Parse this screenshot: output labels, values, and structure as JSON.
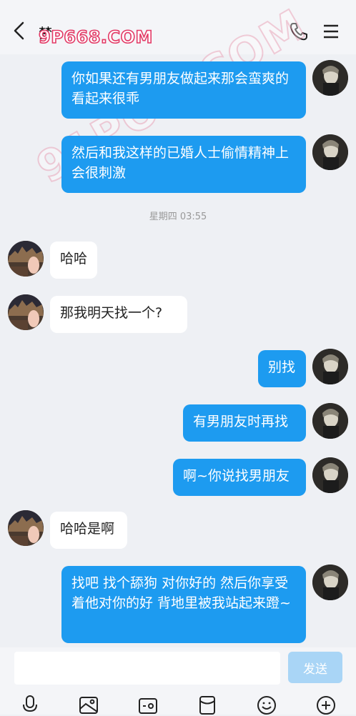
{
  "header": {
    "title": "梦",
    "watermark": "9P668.COM",
    "icons": [
      "back-icon",
      "phone-icon",
      "menu-icon"
    ]
  },
  "watermark_diagonal": "91POR.COM",
  "messages": [
    {
      "from": "me",
      "text": "你如果还有男朋友做起来那会蛮爽的 看起来很乖"
    },
    {
      "from": "me",
      "text": "然后和我这样的已婚人士偷情精神上会很刺激"
    },
    {
      "from": "other",
      "text": "哈哈"
    },
    {
      "from": "other",
      "text": "那我明天找一个?"
    },
    {
      "from": "me",
      "text": "别找"
    },
    {
      "from": "me",
      "text": "有男朋友时再找"
    },
    {
      "from": "me",
      "text": "啊~你说找男朋友"
    },
    {
      "from": "other",
      "text": "哈哈是啊"
    },
    {
      "from": "me",
      "text": "找吧 找个舔狗 对你好的 然后你享受着他对你的好 背地里被我站起来蹬~"
    }
  ],
  "timestamp": "星期四 03:55",
  "input": {
    "placeholder": "",
    "value": ""
  },
  "send_label": "发送",
  "toolbar_icons": [
    "microphone-icon",
    "image-icon",
    "camera-icon",
    "red-packet-icon",
    "emoji-icon",
    "plus-icon"
  ],
  "colors": {
    "my_bubble": "#1d9bf0",
    "other_bubble": "#ffffff",
    "background": "#eef0f4",
    "send_disabled": "#a9d5f6"
  }
}
